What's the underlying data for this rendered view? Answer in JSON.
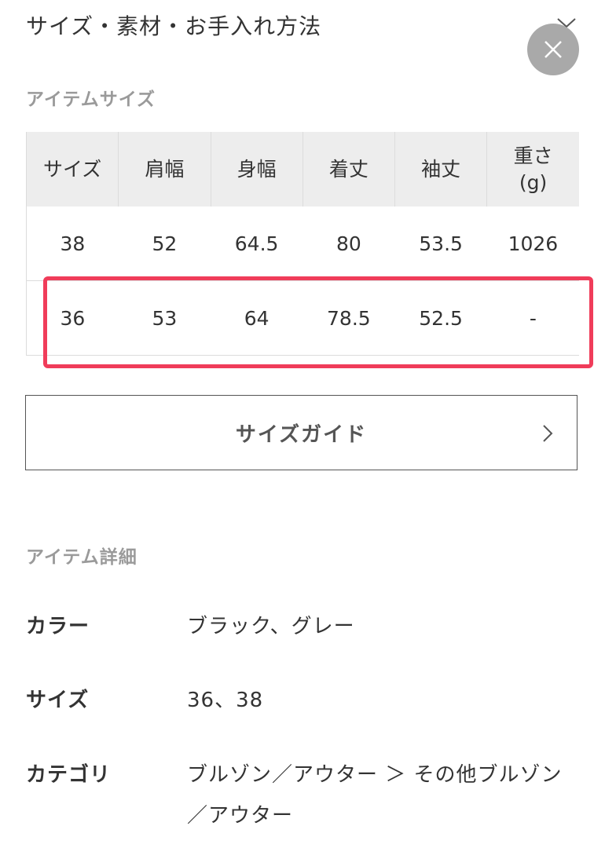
{
  "header": {
    "title": "サイズ・素材・お手入れ方法"
  },
  "icons": {
    "chevron": "chevron-down-icon",
    "close": "close-icon",
    "arrow": "chevron-right-icon"
  },
  "colors": {
    "highlight": "#f03c5a",
    "close_button_bg": "#a9a9a9",
    "table_header_bg": "#ededed",
    "subheading": "#9a9a9a"
  },
  "item_size": {
    "heading": "アイテムサイズ",
    "columns": [
      "サイズ",
      "肩幅",
      "身幅",
      "着丈",
      "袖丈",
      "重さ(g)"
    ],
    "header_cells": {
      "size": "サイズ",
      "shoulder": "肩幅",
      "chest": "身幅",
      "length": "着丈",
      "sleeve": "袖丈",
      "weight_line1": "重さ",
      "weight_line2": "(g)"
    },
    "rows": [
      {
        "size": "38",
        "shoulder": "52",
        "chest": "64.5",
        "length": "80",
        "sleeve": "53.5",
        "weight": "1026"
      },
      {
        "size": "36",
        "shoulder": "53",
        "chest": "64",
        "length": "78.5",
        "sleeve": "52.5",
        "weight": "-"
      }
    ]
  },
  "size_guide": {
    "label": "サイズガイド"
  },
  "item_detail": {
    "heading": "アイテム詳細",
    "color_label": "カラー",
    "color_value": "ブラック、グレー",
    "size_label": "サイズ",
    "size_value": "36、38",
    "category_label": "カテゴリ",
    "category_value": "ブルゾン／アウター ＞ その他ブルゾン／アウター"
  }
}
